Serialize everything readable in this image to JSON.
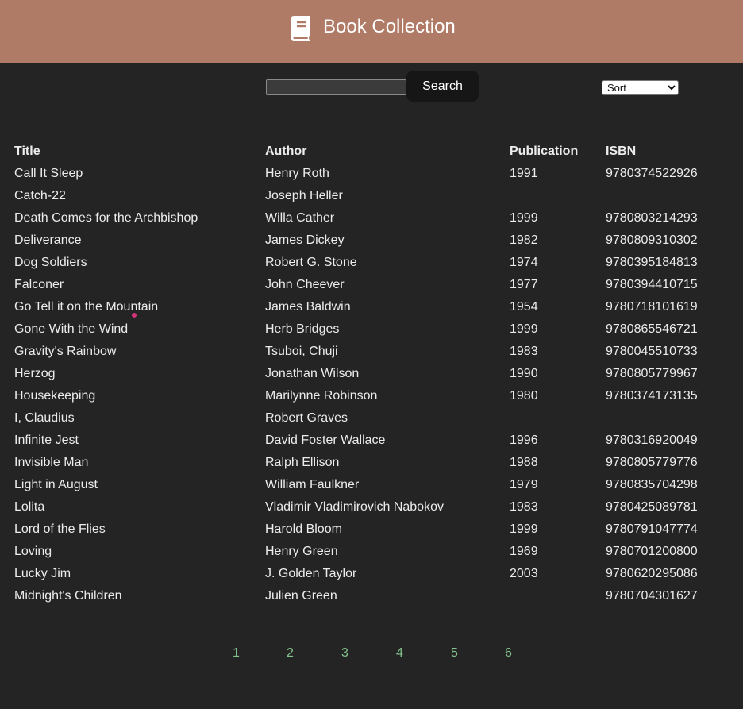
{
  "header": {
    "title": "Book Collection",
    "icon": "book-icon",
    "background_color": "#b07b66"
  },
  "search": {
    "value": "",
    "button_label": "Search"
  },
  "sort": {
    "selected": "Sort"
  },
  "table": {
    "headers": {
      "title": "Title",
      "author": "Author",
      "publication": "Publication",
      "isbn": "ISBN"
    },
    "rows": [
      {
        "title": "Call It Sleep",
        "author": "Henry Roth",
        "publication": "1991",
        "isbn": "9780374522926"
      },
      {
        "title": "Catch-22",
        "author": "Joseph Heller",
        "publication": "",
        "isbn": ""
      },
      {
        "title": "Death Comes for the Archbishop",
        "author": "Willa Cather",
        "publication": "1999",
        "isbn": "9780803214293"
      },
      {
        "title": "Deliverance",
        "author": "James Dickey",
        "publication": "1982",
        "isbn": "9780809310302"
      },
      {
        "title": "Dog Soldiers",
        "author": "Robert G. Stone",
        "publication": "1974",
        "isbn": "9780395184813"
      },
      {
        "title": "Falconer",
        "author": "John Cheever",
        "publication": "1977",
        "isbn": "9780394410715"
      },
      {
        "title": "Go Tell it on the Mountain",
        "author": "James Baldwin",
        "publication": "1954",
        "isbn": "9780718101619"
      },
      {
        "title": "Gone With the Wind",
        "author": "Herb Bridges",
        "publication": "1999",
        "isbn": "9780865546721"
      },
      {
        "title": "Gravity's Rainbow",
        "author": "Tsuboi, Chuji",
        "publication": "1983",
        "isbn": "9780045510733"
      },
      {
        "title": "Herzog",
        "author": "Jonathan Wilson",
        "publication": "1990",
        "isbn": "9780805779967"
      },
      {
        "title": "Housekeeping",
        "author": "Marilynne Robinson",
        "publication": "1980",
        "isbn": "9780374173135"
      },
      {
        "title": "I, Claudius",
        "author": "Robert Graves",
        "publication": "",
        "isbn": ""
      },
      {
        "title": "Infinite Jest",
        "author": "David Foster Wallace",
        "publication": "1996",
        "isbn": "9780316920049"
      },
      {
        "title": "Invisible Man",
        "author": "Ralph Ellison",
        "publication": "1988",
        "isbn": "9780805779776"
      },
      {
        "title": "Light in August",
        "author": "William Faulkner",
        "publication": "1979",
        "isbn": "9780835704298"
      },
      {
        "title": "Lolita",
        "author": "Vladimir Vladimirovich Nabokov",
        "publication": "1983",
        "isbn": "9780425089781"
      },
      {
        "title": "Lord of the Flies",
        "author": "Harold Bloom",
        "publication": "1999",
        "isbn": "9780791047774"
      },
      {
        "title": "Loving",
        "author": "Henry Green",
        "publication": "1969",
        "isbn": "9780701200800"
      },
      {
        "title": "Lucky Jim",
        "author": "J. Golden Taylor",
        "publication": "2003",
        "isbn": "9780620295086"
      },
      {
        "title": "Midnight's Children",
        "author": "Julien Green",
        "publication": "",
        "isbn": "9780704301627"
      }
    ]
  },
  "pagination": {
    "pages": [
      "1",
      "2",
      "3",
      "4",
      "5",
      "6"
    ],
    "link_color": "#83c38c"
  },
  "colors": {
    "background": "#242424",
    "header": "#b07b66",
    "button": "#161616"
  }
}
